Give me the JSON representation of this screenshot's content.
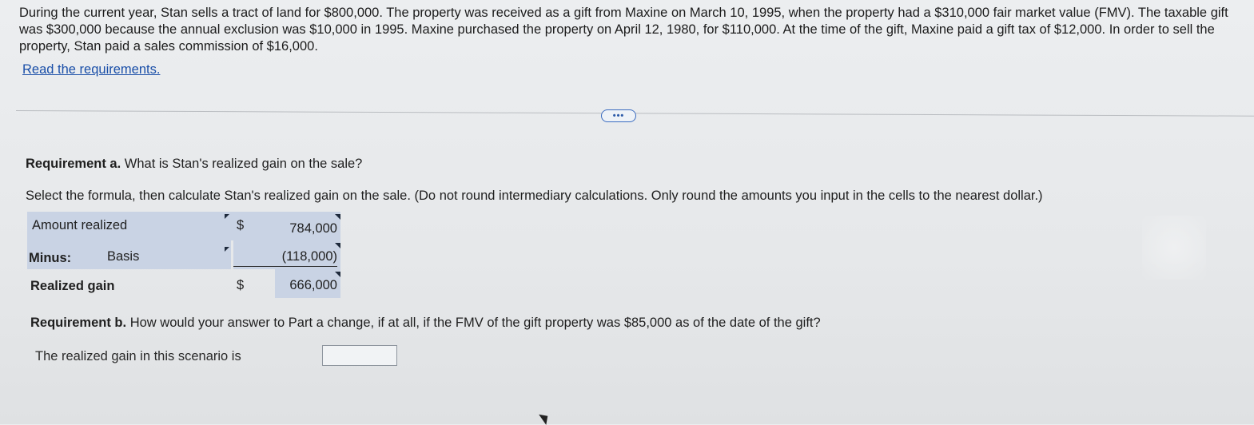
{
  "problem": {
    "text": "During the current year, Stan sells a tract of land for $800,000. The property was received as a gift from Maxine on March 10, 1995, when the property had a $310,000 fair market value (FMV). The taxable gift was $300,000 because the annual exclusion was $10,000 in 1995. Maxine purchased the property on April 12, 1980, for $110,000. At the time of the gift, Maxine paid a gift tax of $12,000. In order to sell the property, Stan paid a sales commission of $16,000."
  },
  "links": {
    "read_requirements": "Read the requirements."
  },
  "more_button": {
    "label": "•••"
  },
  "requirement_a": {
    "bold": "Requirement a.",
    "question": " What is Stan's realized gain on the sale?",
    "instruction": "Select the formula, then calculate Stan's realized gain on the sale. (Do not round intermediary calculations. Only round the amounts you input in the cells to the nearest dollar.)",
    "rows": {
      "amount_realized": {
        "label": "Amount realized",
        "currency": "$",
        "value": "784,000"
      },
      "basis": {
        "prefix": "Minus:",
        "label": "Basis",
        "value": "(118,000)"
      },
      "realized_gain": {
        "label": "Realized gain",
        "currency": "$",
        "value": "666,000"
      }
    }
  },
  "requirement_b": {
    "bold": "Requirement b.",
    "question": " How would your answer to Part a change, if at all, if the FMV of the gift property was $85,000 as of the date of the gift?",
    "scenario_label": "The realized gain in this scenario is",
    "answer_value": ""
  },
  "colors": {
    "link": "#1a4fa8",
    "cell_shade": "#c9d3e4",
    "background": "#e8eaec"
  }
}
